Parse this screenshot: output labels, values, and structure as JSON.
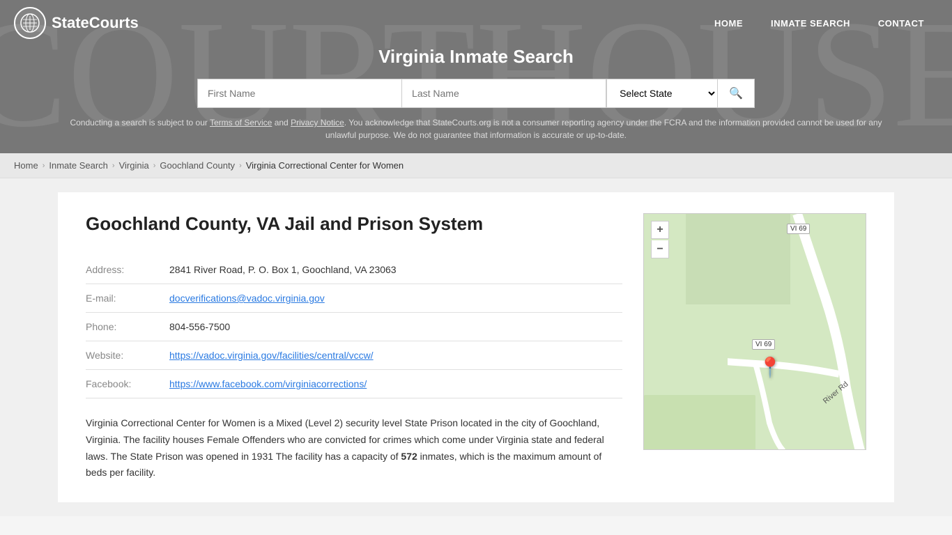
{
  "site": {
    "name": "StateCourts"
  },
  "nav": {
    "home_label": "HOME",
    "inmate_search_label": "INMATE SEARCH",
    "contact_label": "CONTACT"
  },
  "header": {
    "title": "Virginia Inmate Search",
    "search": {
      "first_name_placeholder": "First Name",
      "last_name_placeholder": "Last Name",
      "state_placeholder": "Select State"
    },
    "disclaimer": "Conducting a search is subject to our Terms of Service and Privacy Notice. You acknowledge that StateCourts.org is not a consumer reporting agency under the FCRA and the information provided cannot be used for any unlawful purpose. We do not guarantee that information is accurate or up-to-date."
  },
  "breadcrumb": {
    "items": [
      {
        "label": "Home",
        "href": "#"
      },
      {
        "label": "Inmate Search",
        "href": "#"
      },
      {
        "label": "Virginia",
        "href": "#"
      },
      {
        "label": "Goochland County",
        "href": "#"
      },
      {
        "label": "Virginia Correctional Center for Women",
        "href": null
      }
    ]
  },
  "facility": {
    "title": "Goochland County, VA Jail and Prison System",
    "address_label": "Address:",
    "address_value": "2841 River Road, P. O. Box 1, Goochland, VA 23063",
    "email_label": "E-mail:",
    "email_value": "docverifications@vadoc.virginia.gov",
    "email_href": "mailto:docverifications@vadoc.virginia.gov",
    "phone_label": "Phone:",
    "phone_value": "804-556-7500",
    "website_label": "Website:",
    "website_value": "https://vadoc.virginia.gov/facilities/central/vccw/",
    "facebook_label": "Facebook:",
    "facebook_value": "https://www.facebook.com/virginiacorrections/",
    "description_plain": "Virginia Correctional Center for Women is a Mixed (Level 2) security level State Prison located in the city of Goochland, Virginia. The facility houses Female Offenders who are convicted for crimes which come under Virginia state and federal laws. The State Prison was opened in 1931 The facility has a capacity of ",
    "description_capacity": "572",
    "description_suffix": " inmates, which is the maximum amount of beds per facility."
  },
  "map": {
    "zoom_plus": "+",
    "zoom_minus": "−",
    "label1": "VI 69",
    "label2": "VI 69",
    "road_label": "River Rd"
  }
}
